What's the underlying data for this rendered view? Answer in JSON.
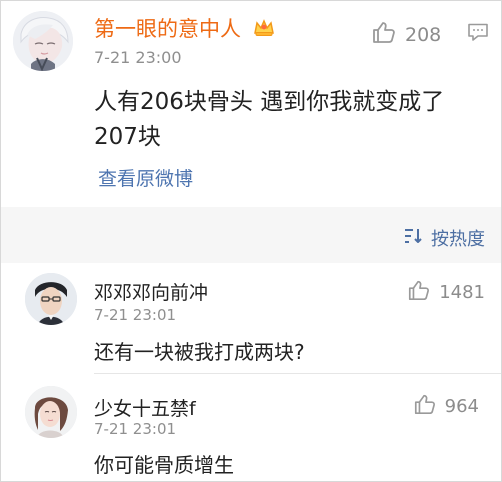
{
  "post": {
    "username": "第一眼的意中人",
    "time": "7-21 23:00",
    "likes": "208",
    "text": "人有206块骨头 遇到你我就变成了207块",
    "view_original": "查看原微博"
  },
  "comments_header": {
    "sort_label": "按热度"
  },
  "comments": [
    {
      "name": "邓邓邓向前冲",
      "time": "7-21 23:01",
      "text": "还有一块被我打成两块?",
      "likes": "1481"
    },
    {
      "name": "少女十五禁f",
      "time": "7-21 23:01",
      "text": "你可能骨质增生",
      "likes": "964"
    }
  ],
  "colors": {
    "username": "#ee6a14",
    "link": "#4e75b0",
    "meta": "#8f8f8f",
    "section_bg": "#f6f6f6"
  },
  "icons": {
    "post_badge": "crown-icon",
    "like": "thumb-up-icon",
    "comment": "comment-icon",
    "sort": "sort-icon"
  }
}
